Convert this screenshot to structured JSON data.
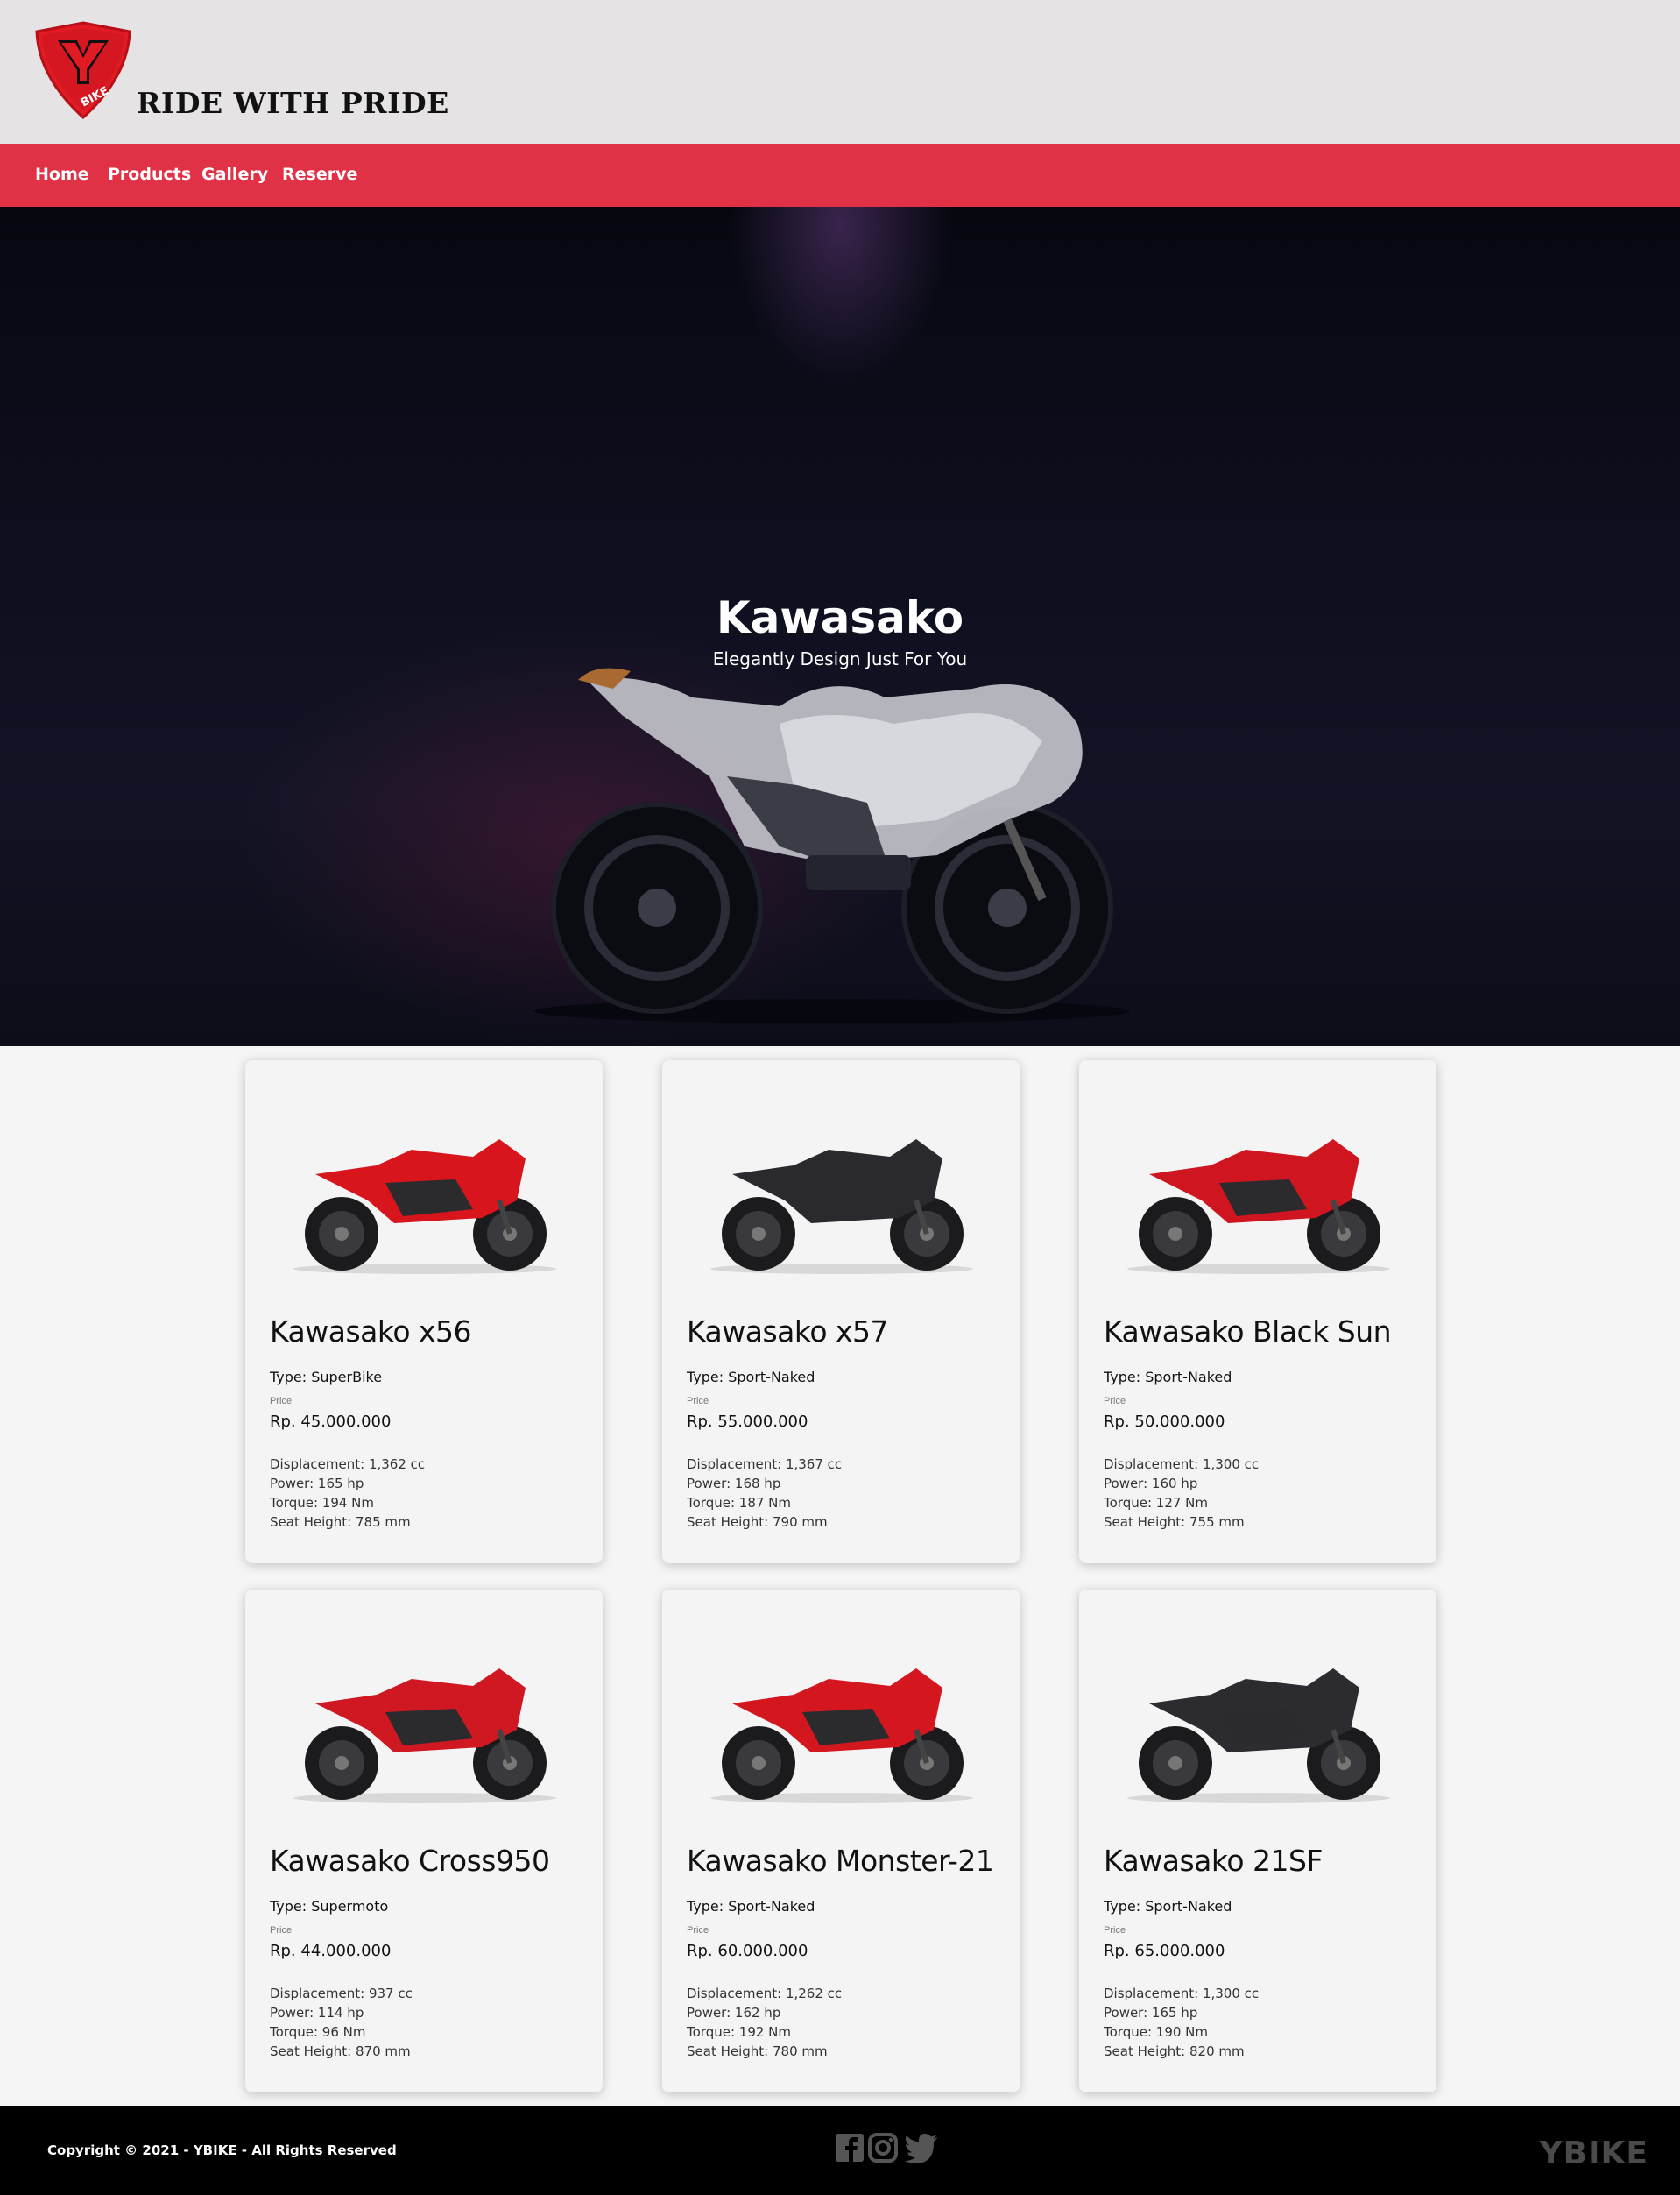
{
  "header": {
    "logo_text": "BIKE",
    "tagline": "RIDE WITH PRIDE"
  },
  "nav": {
    "items": [
      {
        "label": "Home"
      },
      {
        "label": "Products"
      },
      {
        "label": "Gallery"
      },
      {
        "label": "Reserve"
      }
    ]
  },
  "hero": {
    "title": "Kawasako",
    "subtitle": "Elegantly Design Just For You"
  },
  "products": [
    {
      "name": "Kawasako x56",
      "type": "Type: SuperBike",
      "price_label": "Price",
      "price": "Rp. 45.000.000",
      "displacement": "Displacement: 1,362 cc",
      "power": "Power: 165 hp",
      "torque": "Torque: 194 Nm",
      "seat": "Seat Height: 785 mm",
      "color": "#d8141d"
    },
    {
      "name": "Kawasako x57",
      "type": "Type: Sport-Naked",
      "price_label": "Price",
      "price": "Rp. 55.000.000",
      "displacement": "Displacement: 1,367 cc",
      "power": "Power: 168 hp",
      "torque": "Torque: 187 Nm",
      "seat": "Seat Height: 790 mm",
      "color": "#2a2a2e"
    },
    {
      "name": "Kawasako Black Sun",
      "type": "Type: Sport-Naked",
      "price_label": "Price",
      "price": "Rp. 50.000.000",
      "displacement": "Displacement: 1,300 cc",
      "power": "Power: 160 hp",
      "torque": "Torque: 127 Nm",
      "seat": "Seat Height: 755 mm",
      "color": "#cf1520"
    },
    {
      "name": "Kawasako Cross950",
      "type": "Type: Supermoto",
      "price_label": "Price",
      "price": "Rp. 44.000.000",
      "displacement": "Displacement: 937 cc",
      "power": "Power: 114 hp",
      "torque": "Torque: 96 Nm",
      "seat": "Seat Height: 870 mm",
      "color": "#d01822"
    },
    {
      "name": "Kawasako Monster-21",
      "type": "Type: Sport-Naked",
      "price_label": "Price",
      "price": "Rp. 60.000.000",
      "displacement": "Displacement: 1,262 cc",
      "power": "Power: 162 hp",
      "torque": "Torque: 192 Nm",
      "seat": "Seat Height: 780 mm",
      "color": "#d4161f"
    },
    {
      "name": "Kawasako 21SF",
      "type": "Type: Sport-Naked",
      "price_label": "Price",
      "price": "Rp. 65.000.000",
      "displacement": "Displacement: 1,300 cc",
      "power": "Power: 165 hp",
      "torque": "Torque: 190 Nm",
      "seat": "Seat Height: 820 mm",
      "color": "#2b2b30"
    }
  ],
  "footer": {
    "copyright": "Copyright © 2021 - YBIKE - All Rights Reserved",
    "brand": "YBIKE",
    "social": [
      "facebook-icon",
      "instagram-icon",
      "twitter-icon"
    ]
  },
  "colors": {
    "accent": "#e03147",
    "header_bg": "#e6e3e4",
    "footer_bg": "#000000"
  }
}
